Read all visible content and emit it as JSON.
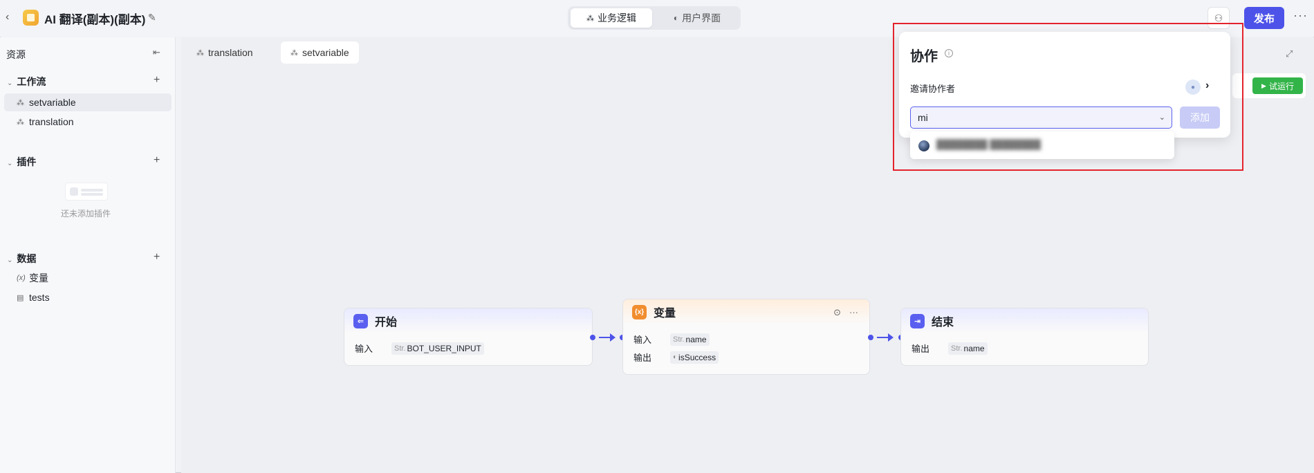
{
  "header": {
    "app_title": "AI 翻译(副本)(副本)",
    "tabs": [
      {
        "label": "业务逻辑",
        "icon": "workflow-icon",
        "active": true
      },
      {
        "label": "用户界面",
        "icon": "palette-icon",
        "active": false
      }
    ],
    "publish_label": "发布"
  },
  "sidebar": {
    "title": "资源",
    "groups": [
      {
        "label": "工作流",
        "items": [
          {
            "label": "setvariable",
            "icon": "workflow-icon",
            "selected": true
          },
          {
            "label": "translation",
            "icon": "workflow-icon",
            "selected": false
          }
        ]
      },
      {
        "label": "插件",
        "items": [],
        "empty_text": "还未添加插件"
      },
      {
        "label": "数据",
        "items": [
          {
            "label": "变量",
            "icon": "variable-icon"
          },
          {
            "label": "tests",
            "icon": "file-icon"
          }
        ]
      }
    ]
  },
  "canvas": {
    "tabs": [
      {
        "label": "translation",
        "active": false
      },
      {
        "label": "setvariable",
        "active": true
      }
    ],
    "test_run_label": "试运行",
    "nodes": {
      "start": {
        "title": "开始",
        "row_label": "输入",
        "chip_type": "Str.",
        "chip_value": "BOT_USER_INPUT"
      },
      "variable": {
        "title": "变量",
        "input_label": "输入",
        "input_type": "Str.",
        "input_value": "name",
        "output_label": "输出",
        "output_value": "isSuccess"
      },
      "end": {
        "title": "结束",
        "row_label": "输出",
        "chip_type": "Str.",
        "chip_value": "name"
      }
    }
  },
  "collab_popup": {
    "title": "协作",
    "invite_label": "邀请协作者",
    "input_value": "mi",
    "add_label": "添加"
  },
  "colors": {
    "accent": "#4d53e8",
    "run_green": "#33b449",
    "highlight_red": "#e3232c"
  }
}
